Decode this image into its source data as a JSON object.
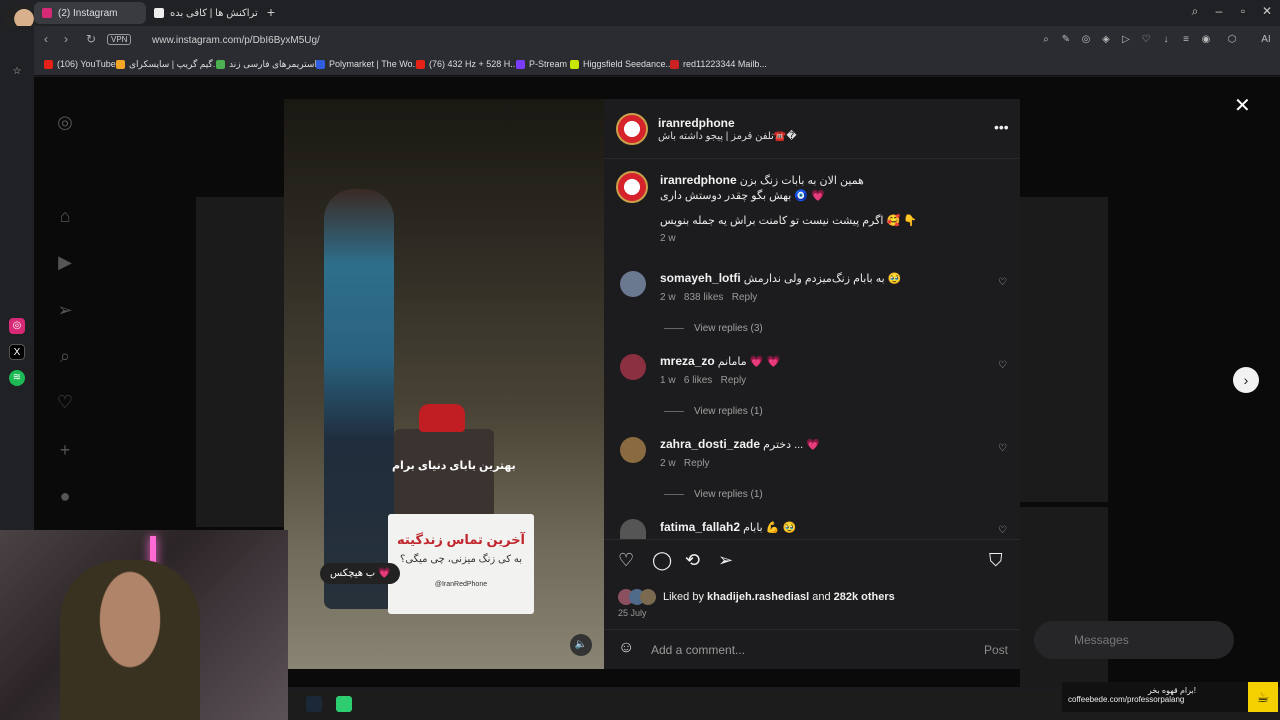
{
  "browser": {
    "tabs": [
      {
        "label": "(2) Instagram",
        "active": true
      },
      {
        "label": "تراکنش ها | کافی بده",
        "active": false
      }
    ],
    "new_tab": "+",
    "url": "www.instagram.com/p/DbI6ByxM5Ug/",
    "vpn_label": "VPN",
    "ai_label": "AI",
    "bookmarks": [
      {
        "label": "(106) YouTube",
        "color": "#e62117"
      },
      {
        "label": "گیم گریپ | سایسکرای...",
        "color": "#f5a623"
      },
      {
        "label": "استریمرهای فارسی زند...",
        "color": "#4caf50"
      },
      {
        "label": "Polymarket | The Wo...",
        "color": "#2f5fe0"
      },
      {
        "label": "(76) 432 Hz + 528 H...",
        "color": "#e62117"
      },
      {
        "label": "P-Stream",
        "color": "#7a3cff"
      },
      {
        "label": "Higgsfield Seedance...",
        "color": "#c8e600"
      },
      {
        "label": "red11223344 Mailb...",
        "color": "#cc2222"
      }
    ]
  },
  "post": {
    "image_text": "بهترین بابای دنیای برام",
    "sign_title": "آخرین تماس زندگیته",
    "sign_subtitle": "به کی زنگ میزنی، چی میگی؟",
    "sign_handle": "@IranRedPhone",
    "reply_bubble": "ب هیچکس 💗"
  },
  "panel": {
    "author": "iranredphone",
    "bio": "تلفن قرمز | پیجو داشته باش☎️�",
    "caption_line1": "همین الان به بابات زنگ بزن",
    "caption_line2": "بهش بگو چقدر دوستش داری 🧿 💗",
    "caption_line3": "اگرم پیشت نیست تو کامنت براش یه جمله بنویس 🥰 👇",
    "caption_time": "2 w",
    "comments": [
      {
        "user": "somayeh_lotfi",
        "text": "به بابام زنگ‌میزدم ولی ندارمش 🥹",
        "time": "2 w",
        "likes": "838 likes",
        "reply": "Reply",
        "view_replies": "View replies (3)"
      },
      {
        "user": "mreza_zo",
        "text": "مامانم 💗 💗",
        "time": "1 w",
        "likes": "6 likes",
        "reply": "Reply",
        "view_replies": "View replies (1)"
      },
      {
        "user": "zahra_dosti_zade",
        "text": "دخترم ... 💗",
        "time": "2 w",
        "likes": "",
        "reply": "Reply",
        "view_replies": "View replies (1)"
      },
      {
        "user": "fatima_fallah2",
        "text": "بابام 💪 🥹",
        "time": "",
        "likes": "",
        "reply": "",
        "view_replies": ""
      }
    ],
    "liked_prefix": "Liked by",
    "liked_user": "khadijeh.rashediasl",
    "liked_and": "and",
    "liked_others": "282k others",
    "date": "25 July",
    "add_comment_placeholder": "Add a comment...",
    "post_button": "Post"
  },
  "messages_label": "Messages",
  "coffee": {
    "line1": "برام قهوه بخر!",
    "line2": "coffeebede.com/professorpalang"
  }
}
